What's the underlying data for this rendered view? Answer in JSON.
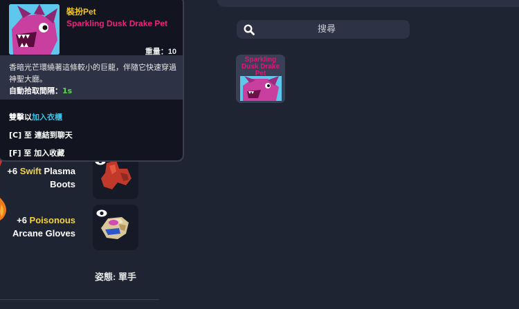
{
  "search": {
    "placeholder": "搜尋"
  },
  "result_item": {
    "label": "Sparkling Dusk Drake Pet"
  },
  "equipment": [
    {
      "prefix": "+6 ",
      "modifier": "Swift",
      "name_rest": " Plasma",
      "name_line2": "Boots"
    },
    {
      "prefix": "+6 ",
      "modifier": "Poisonous",
      "name_rest": "",
      "name_line2": "Arcane Gloves"
    }
  ],
  "stance": {
    "label": "姿態:",
    "value": " 單手"
  },
  "tooltip": {
    "type": "裝扮Pet",
    "name": "Sparkling Dusk Drake Pet",
    "weight_label": "重量：",
    "weight_value": "10",
    "description": "香暗光芒環繞著這條較小的巨龍，伴隨它快速穿過神聖大廳。",
    "pickup_label": "自動拾取間隔：",
    "pickup_value": "1s",
    "action1_prefix": "雙擊以",
    "action1_link": "加入衣櫃",
    "action2": "[C] 至 連結到聊天",
    "action3": "[F] 至 加入收藏"
  },
  "colors": {
    "background": "#1f2433",
    "modifier_gold": "#f5d33b",
    "pet_name_pink": "#f0207f",
    "type_yellow": "#f5c518",
    "pickup_green": "#5bd94e",
    "link_cyan": "#35c2e6"
  }
}
